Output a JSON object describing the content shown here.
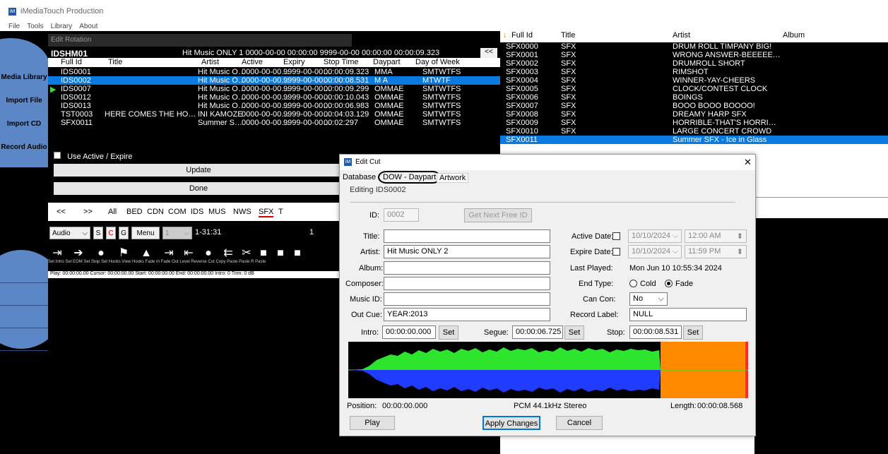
{
  "app": {
    "title": "iMediaTouch Production",
    "logo_text": "iM"
  },
  "menu": [
    "File",
    "Tools",
    "Library",
    "About"
  ],
  "sidebar": [
    "Media Library",
    "Import File",
    "Import CD",
    "Record Audio"
  ],
  "rotation": {
    "window_title": "Edit Rotation",
    "id": "IDSHM01",
    "summary": "Hit Music ONLY 1   0000-00-00 00:00:00  9999-00-00 00:00:00  00:00:09.323",
    "collapse": "<<",
    "columns": [
      "Full Id",
      "Title",
      "Artist",
      "Active",
      "Expiry",
      "Stop Time",
      "Daypart",
      "Day of Week"
    ],
    "rows": [
      {
        "id": "IDS0001",
        "title": "",
        "artist": "Hit Music O…",
        "active": "0000-00-00…",
        "expiry": "9999-00-00…",
        "stop": "00:00:09.323",
        "daypart": "MMA",
        "dow": "SMTWTFS",
        "selected": false
      },
      {
        "id": "IDS0002",
        "title": "",
        "artist": "Hit Music O…",
        "active": "0000-00-00…",
        "expiry": "9999-00-00…",
        "stop": "00:00:08.531",
        "daypart": "M  A",
        "dow": "MTWTF",
        "selected": true
      },
      {
        "id": "IDS0007",
        "title": "",
        "artist": "Hit Music O…",
        "active": "0000-00-00…",
        "expiry": "9999-00-00…",
        "stop": "00:00:09.299",
        "daypart": "OMMAE",
        "dow": "SMTWTFS",
        "selected": false
      },
      {
        "id": "IDS0012",
        "title": "",
        "artist": "Hit Music O…",
        "active": "0000-00-00…",
        "expiry": "9999-00-00…",
        "stop": "00:00:10.043",
        "daypart": "OMMAE",
        "dow": "SMTWTFS",
        "selected": false
      },
      {
        "id": "IDS0013",
        "title": "",
        "artist": "Hit Music O…",
        "active": "0000-00-00…",
        "expiry": "9999-00-00…",
        "stop": "00:00:06.983",
        "daypart": "OMMAE",
        "dow": "SMTWTFS",
        "selected": false
      },
      {
        "id": "TST0003",
        "title": "HERE COMES THE HO…",
        "artist": "INI KAMOZE",
        "active": "0000-00-00…",
        "expiry": "9999-00-00…",
        "stop": "00:04:03.129",
        "daypart": "OMMAE",
        "dow": "SMTWTFS",
        "selected": false
      },
      {
        "id": "SFX0011",
        "title": "",
        "artist": "Summer S…",
        "active": "0000-00-00…",
        "expiry": "9999-00-00…",
        "stop": "00:02:297",
        "daypart": "OMMAE",
        "dow": "SMTWTFS",
        "selected": false
      }
    ],
    "use_active_label": "Use Active / Expire",
    "update_label": "Update",
    "done_label": "Done"
  },
  "filter_tabs": [
    "<<",
    ">>",
    "All",
    "BED",
    "CDN",
    "COM",
    "IDS",
    "MUS",
    "NWS",
    "SFX",
    "T"
  ],
  "toolbar": {
    "audio": "Audio",
    "s": "S",
    "c": "C",
    "g": "G",
    "menu": "Menu",
    "num": "1",
    "range": "1-31:31",
    "count": "1"
  },
  "edit_tools": [
    "Set Intro",
    "Set EOM",
    "Set Stop",
    "Set Hooks",
    "View Hooks",
    "Fade In",
    "Fade Out",
    "Level",
    "Reverse",
    "Cut",
    "Copy",
    "Paste",
    "Paste R",
    "Paste"
  ],
  "edit_tool_icons": [
    "set-intro-icon",
    "set-eom-icon",
    "set-stop-icon",
    "set-hooks-icon",
    "view-hooks-icon",
    "fade-in-icon",
    "fade-out-icon",
    "level-icon",
    "reverse-icon",
    "cut-icon",
    "copy-icon",
    "paste-icon"
  ],
  "status": "Play: 00:00:00.00   Cursor: 00:00:00.00   Start: 00:00:00.00   End: 00:00:00.00   Intro: 0     Trim: 0 dB",
  "library": {
    "columns": [
      "Full Id",
      "Title",
      "Artist",
      "Album"
    ],
    "rows": [
      {
        "id": "SFX0000",
        "title": "SFX",
        "artist": "DRUM ROLL TIMPANY BIG!",
        "selected": false
      },
      {
        "id": "SFX0001",
        "title": "SFX",
        "artist": "WRONG ANSWER-BEEEEE…",
        "selected": false
      },
      {
        "id": "SFX0002",
        "title": "SFX",
        "artist": "DRUMROLL SHORT",
        "selected": false
      },
      {
        "id": "SFX0003",
        "title": "SFX",
        "artist": "RIMSHOT",
        "selected": false
      },
      {
        "id": "SFX0004",
        "title": "SFX",
        "artist": "WINNER-YAY-CHEERS",
        "selected": false
      },
      {
        "id": "SFX0005",
        "title": "SFX",
        "artist": "CLOCK/CONTEST CLOCK",
        "selected": false
      },
      {
        "id": "SFX0006",
        "title": "SFX",
        "artist": "BOINGS",
        "selected": false
      },
      {
        "id": "SFX0007",
        "title": "SFX",
        "artist": "BOOO BOOO BOOOO!",
        "selected": false
      },
      {
        "id": "SFX0008",
        "title": "SFX",
        "artist": "DREAMY HARP SFX",
        "selected": false
      },
      {
        "id": "SFX0009",
        "title": "SFX",
        "artist": "HORRIBLE-THAT'S HORRI…",
        "selected": false
      },
      {
        "id": "SFX0010",
        "title": "SFX",
        "artist": "LARGE CONCERT CROWD",
        "selected": false
      },
      {
        "id": "SFX0011",
        "title": "",
        "artist": "Summer SFX - Ice in Glass",
        "selected": true
      }
    ]
  },
  "dialog": {
    "title": "Edit Cut",
    "close": "✕",
    "tabs": [
      "Database",
      "DOW - Daypart",
      "Artwork"
    ],
    "editing": "Editing IDS0002",
    "id_label": "ID:",
    "id_value": "0002",
    "next_id_button": "Get Next Free ID",
    "title_label": "Title:",
    "title_value": "",
    "artist_label": "Artist:",
    "artist_value": "Hit Music ONLY 2",
    "album_label": "Album:",
    "composer_label": "Composer:",
    "music_id_label": "Music ID:",
    "out_cue_label": "Out Cue:",
    "out_cue_value": "YEAR:2013",
    "active_date_label": "Active Date:",
    "active_date": "10/10/2024",
    "active_time": "12:00 AM",
    "expire_date_label": "Expire Date:",
    "expire_date": "10/10/2024",
    "expire_time": "11:59 PM",
    "last_played_label": "Last Played:",
    "last_played": "Mon Jun 10 10:55:34 2024",
    "end_type_label": "End Type:",
    "end_cold": "Cold",
    "end_fade": "Fade",
    "can_con_label": "Can Con:",
    "can_con_value": "No",
    "record_label_label": "Record Label:",
    "record_label_value": "NULL",
    "intro_label": "Intro:",
    "intro_value": "00:00:00.000",
    "segue_label": "Segue:",
    "segue_value": "00:00:06.725",
    "stop_label": "Stop:",
    "stop_value": "00:00:08.531",
    "set_label": "Set",
    "position_label": "Position:",
    "position_value": "00:00:00.000",
    "format": "PCM  44.1kHz Stereo",
    "length_label": "Length:",
    "length_value": "00:00:08.568",
    "play_button": "Play",
    "apply_button": "Apply Changes",
    "cancel_button": "Cancel",
    "wave_colors": {
      "top": "#2de52d",
      "bottom": "#1f3cff",
      "marker": "#ff8a00",
      "end": "#ff2a2a"
    }
  }
}
